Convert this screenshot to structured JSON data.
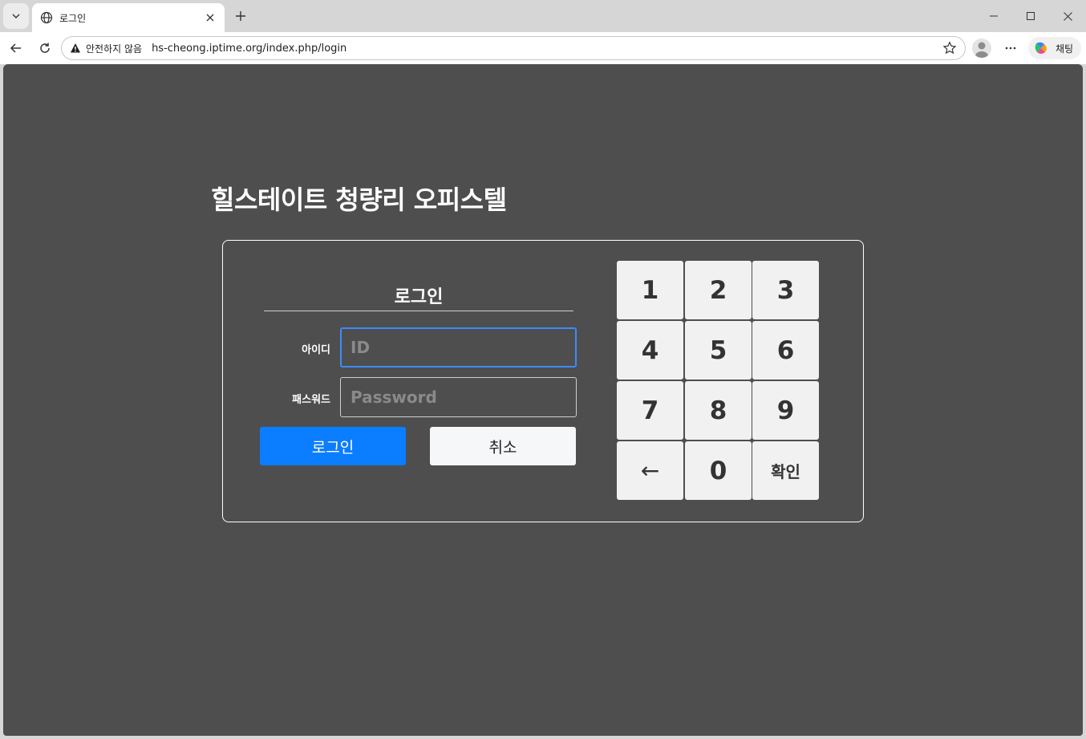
{
  "browser": {
    "tab_title": "로그인",
    "insecure_label": "안전하지 않음",
    "url": "hs-cheong.iptime.org/index.php/login",
    "chat_label": "채팅"
  },
  "page": {
    "site_title": "힐스테이트 청량리 오피스텔",
    "login_heading": "로그인",
    "id_label": "아이디",
    "id_placeholder": "ID",
    "password_label": "패스워드",
    "password_placeholder": "Password",
    "login_button": "로그인",
    "cancel_button": "취소"
  },
  "keypad": {
    "keys": [
      "1",
      "2",
      "3",
      "4",
      "5",
      "6",
      "7",
      "8",
      "9",
      "←",
      "0",
      "확인"
    ]
  },
  "colors": {
    "page_background": "#4e4e4e",
    "primary_button": "#0b7dff",
    "focus_border": "#3d8bfd"
  }
}
